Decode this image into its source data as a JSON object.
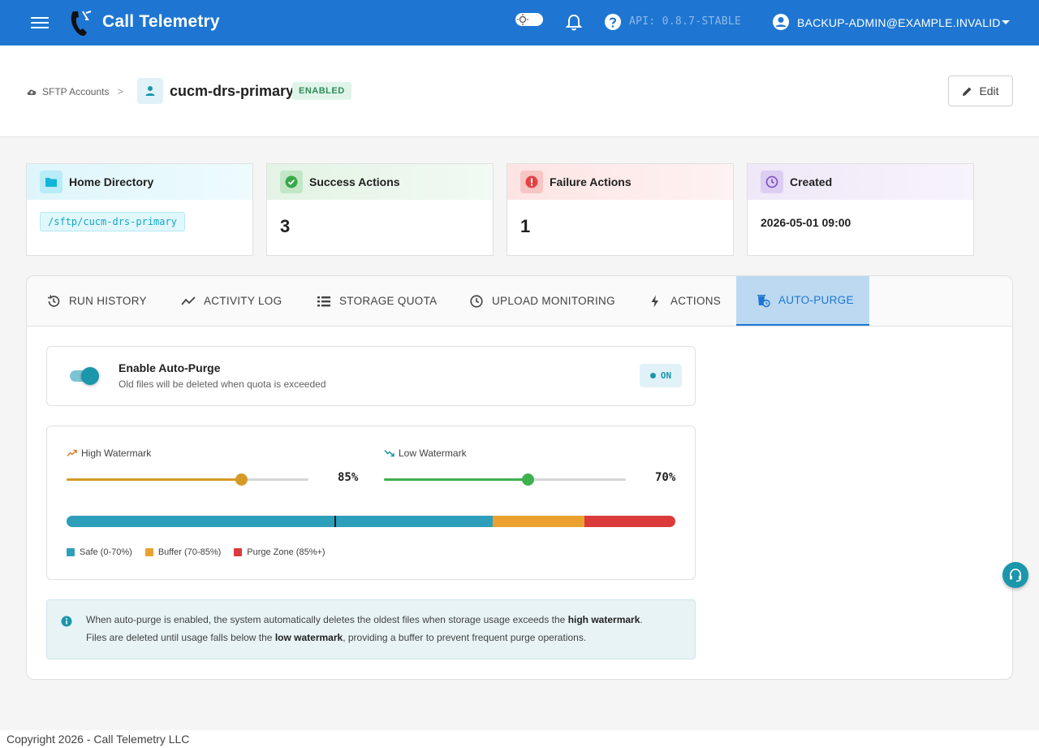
{
  "app": {
    "title": "Call Telemetry",
    "api_version": "API: 0.8.7-STABLE",
    "user": "BACKUP-ADMIN@EXAMPLE.INVALID"
  },
  "breadcrumb": {
    "parent": "SFTP Accounts",
    "separator": ">"
  },
  "account": {
    "name": "cucm-drs-primary",
    "status": "ENABLED",
    "edit_label": "Edit"
  },
  "cards": {
    "home": {
      "label": "Home Directory",
      "value": "/sftp/cucm-drs-primary"
    },
    "success": {
      "label": "Success Actions",
      "value": "3"
    },
    "failure": {
      "label": "Failure Actions",
      "value": "1"
    },
    "created": {
      "label": "Created",
      "value": "2026-05-01 09:00"
    }
  },
  "tabs": [
    {
      "label": "RUN HISTORY"
    },
    {
      "label": "ACTIVITY LOG"
    },
    {
      "label": "STORAGE QUOTA"
    },
    {
      "label": "UPLOAD MONITORING"
    },
    {
      "label": "ACTIONS"
    },
    {
      "label": "AUTO-PURGE"
    }
  ],
  "active_tab": "AUTO-PURGE",
  "auto_purge": {
    "enabled": true,
    "title": "Enable Auto-Purge",
    "subtitle": "Old files will be deleted when quota is exceeded",
    "status_badge": "ON",
    "high": {
      "label": "High Watermark",
      "value": 85,
      "display": "85%"
    },
    "low": {
      "label": "Low Watermark",
      "value": 70,
      "display": "70%"
    },
    "legend": [
      {
        "label": "Safe (0-70%)",
        "color": "#2e9fbb"
      },
      {
        "label": "Buffer (70-85%)",
        "color": "#eba12f"
      },
      {
        "label": "Purge Zone (85%+)",
        "color": "#dc3b3b"
      }
    ],
    "info": {
      "line1_prefix": "When auto-purge is enabled, the system automatically deletes the oldest files when storage usage exceeds the ",
      "line1_bold": "high watermark",
      "line1_suffix": ".",
      "line2_prefix": "Files are deleted until usage falls below the ",
      "line2_bold": "low watermark",
      "line2_suffix": ", providing a buffer to prevent frequent purge operations."
    }
  },
  "colors": {
    "primary": "#1e76d2",
    "teal": "#1b96ab",
    "high_slider": "#d49a25",
    "low_slider": "#3fb04e"
  },
  "footer": "Copyright 2026 - Call Telemetry LLC"
}
